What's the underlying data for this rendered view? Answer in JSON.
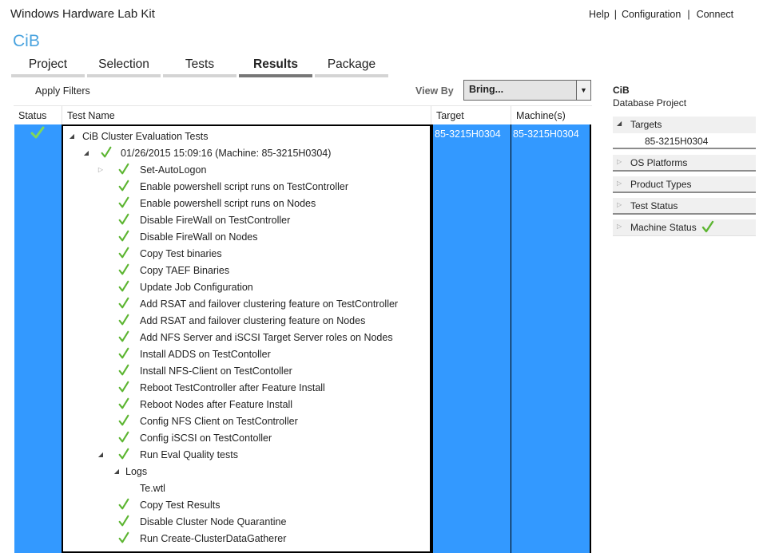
{
  "app": {
    "title": "Windows Hardware Lab Kit",
    "links": [
      "Help",
      "Configuration",
      "Connect"
    ],
    "project_name": "CiB"
  },
  "tabs": [
    {
      "label": "Project",
      "active": false
    },
    {
      "label": "Selection",
      "active": false
    },
    {
      "label": "Tests",
      "active": false
    },
    {
      "label": "Results",
      "active": true
    },
    {
      "label": "Package",
      "active": false
    }
  ],
  "toolbar": {
    "apply_filters": "Apply Filters",
    "view_by_label": "View By",
    "view_by_value": "Bring...",
    "dropdown_icon": "chevron-down-icon"
  },
  "grid": {
    "columns": [
      "Status",
      "Test Name",
      "Target",
      "Machine(s)"
    ],
    "status_icon": "check-icon",
    "target": "85-3215H0304",
    "machine": "85-3215H0304",
    "selected_color": "#3399ff",
    "tree": [
      {
        "level": 0,
        "expander": "expanded",
        "check": false,
        "text": "CiB Cluster Evaluation Tests"
      },
      {
        "level": 1,
        "expander": "expanded",
        "check": true,
        "text": "01/26/2015 15:09:16 (Machine: 85-3215H0304)"
      },
      {
        "level": 2,
        "expander": "collapsed",
        "check": true,
        "text": "Set-AutoLogon"
      },
      {
        "level": 2,
        "expander": "none",
        "check": true,
        "text": "Enable powershell script runs on TestController"
      },
      {
        "level": 2,
        "expander": "none",
        "check": true,
        "text": "Enable powershell script runs on Nodes"
      },
      {
        "level": 2,
        "expander": "none",
        "check": true,
        "text": "Disable FireWall on TestController"
      },
      {
        "level": 2,
        "expander": "none",
        "check": true,
        "text": "Disable FireWall on Nodes"
      },
      {
        "level": 2,
        "expander": "none",
        "check": true,
        "text": "Copy Test binaries"
      },
      {
        "level": 2,
        "expander": "none",
        "check": true,
        "text": "Copy TAEF Binaries"
      },
      {
        "level": 2,
        "expander": "none",
        "check": true,
        "text": "Update Job Configuration"
      },
      {
        "level": 2,
        "expander": "none",
        "check": true,
        "text": "Add RSAT and failover clustering feature on TestController"
      },
      {
        "level": 2,
        "expander": "none",
        "check": true,
        "text": "Add RSAT and failover clustering feature on Nodes"
      },
      {
        "level": 2,
        "expander": "none",
        "check": true,
        "text": "Add NFS Server and iSCSI Target Server roles on Nodes"
      },
      {
        "level": 2,
        "expander": "none",
        "check": true,
        "text": "Install ADDS on TestContoller"
      },
      {
        "level": 2,
        "expander": "none",
        "check": true,
        "text": "Install NFS-Client on TestContoller"
      },
      {
        "level": 2,
        "expander": "none",
        "check": true,
        "text": "Reboot TestController after Feature Install"
      },
      {
        "level": 2,
        "expander": "none",
        "check": true,
        "text": "Reboot Nodes after Feature Install"
      },
      {
        "level": 2,
        "expander": "none",
        "check": true,
        "text": "Config NFS Client on TestController"
      },
      {
        "level": 2,
        "expander": "none",
        "check": true,
        "text": "Config iSCSI on TestContoller"
      },
      {
        "level": 2,
        "expander": "expanded",
        "check": true,
        "text": "Run Eval Quality tests"
      },
      {
        "level": 3,
        "expander": "expanded",
        "check": false,
        "text": "Logs"
      },
      {
        "level": 4,
        "expander": "none",
        "check": false,
        "text": "Te.wtl"
      },
      {
        "level": 2,
        "expander": "none",
        "check": true,
        "text": "Copy Test Results"
      },
      {
        "level": 2,
        "expander": "none",
        "check": true,
        "text": "Disable Cluster Node Quarantine"
      },
      {
        "level": 2,
        "expander": "none",
        "check": true,
        "text": "Run Create-ClusterDataGatherer"
      }
    ]
  },
  "right_panel": {
    "title": "CiB",
    "subtitle": "Database Project",
    "sections": [
      {
        "label": "Targets",
        "expanded": true,
        "items": [
          "85-3215H0304"
        ],
        "check": false
      },
      {
        "label": "OS Platforms",
        "expanded": false,
        "check": false
      },
      {
        "label": "Product Types",
        "expanded": false,
        "check": false
      },
      {
        "label": "Test Status",
        "expanded": false,
        "check": false
      },
      {
        "label": "Machine Status",
        "expanded": false,
        "check": true
      }
    ]
  },
  "colors": {
    "accent": "#4aa3df",
    "check_green": "#5cb531",
    "selection_blue": "#3399ff"
  }
}
